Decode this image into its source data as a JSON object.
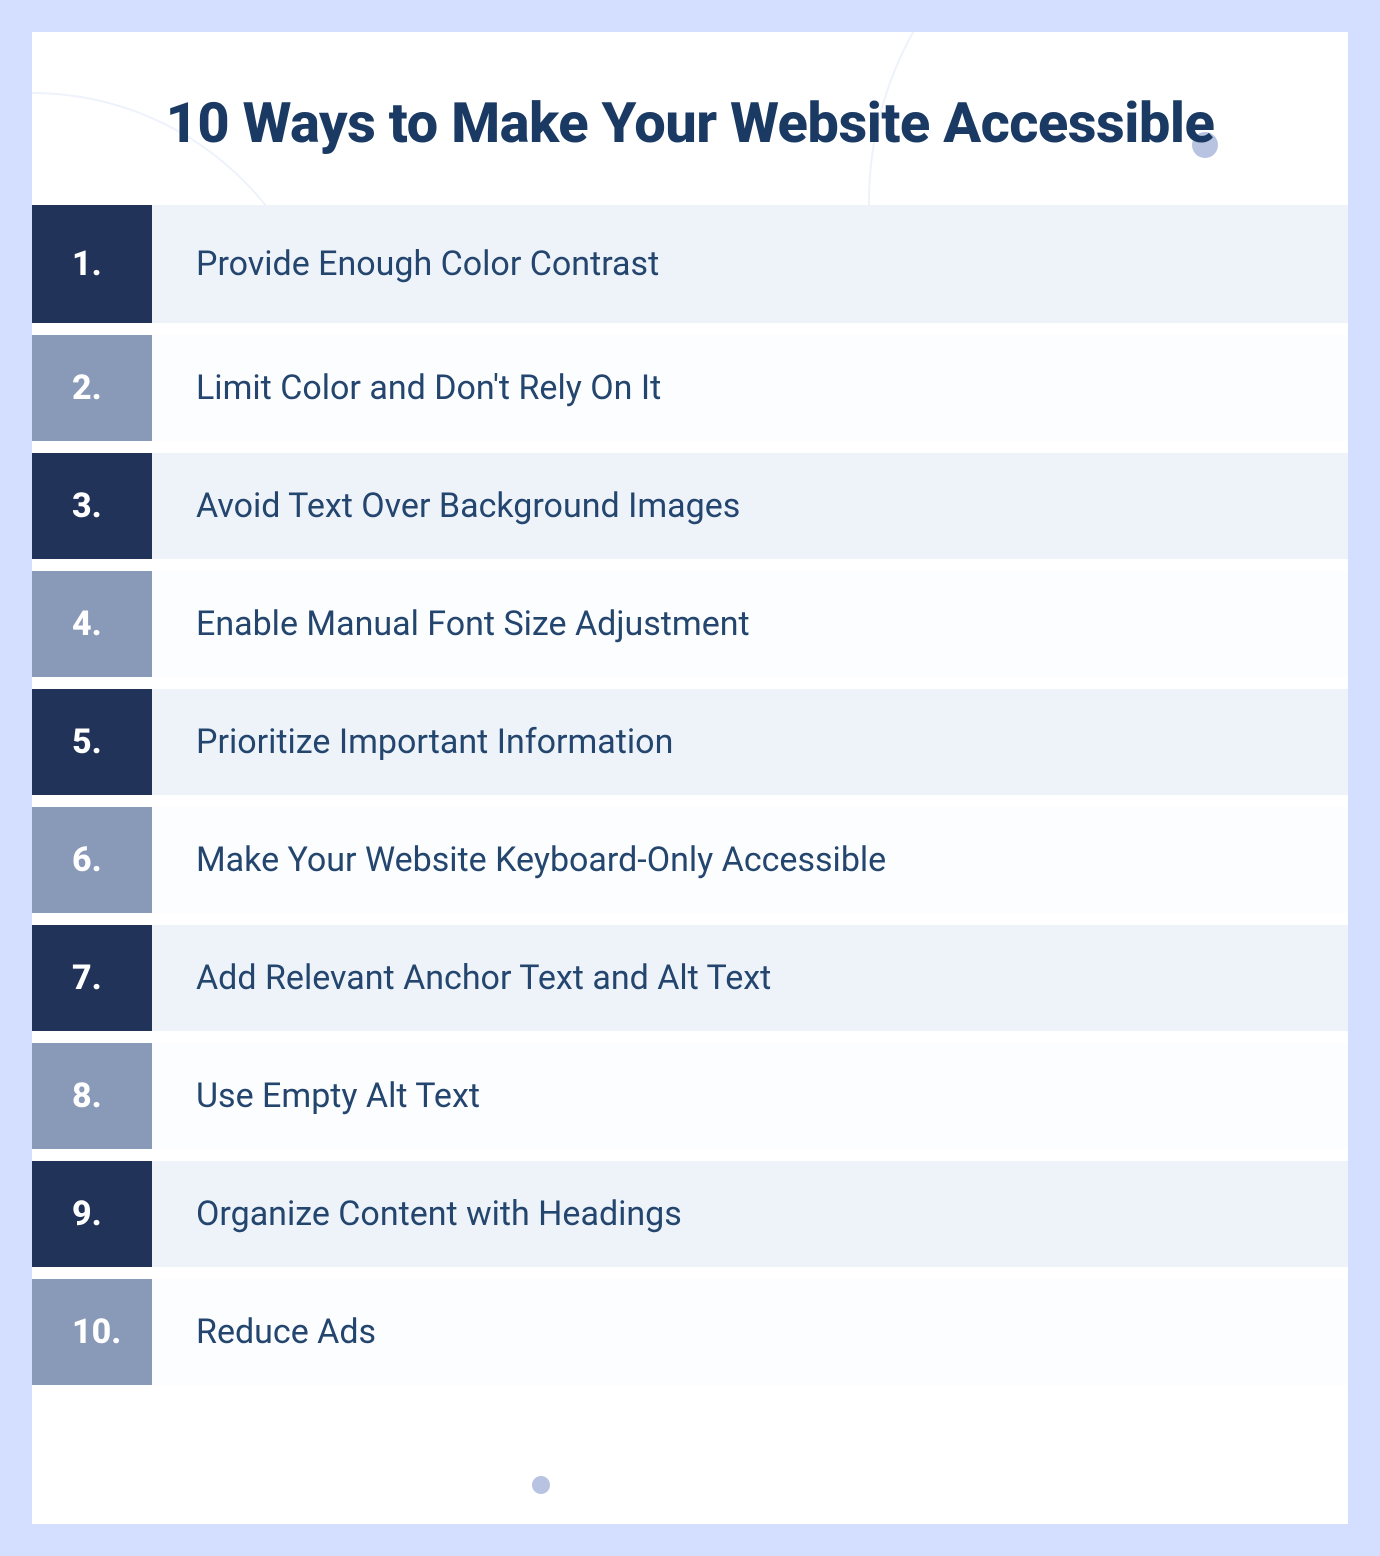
{
  "title": "10 Ways to Make Your Website Accessible",
  "items": [
    {
      "num": "1.",
      "text": "Provide Enough Color Contrast"
    },
    {
      "num": "2.",
      "text": "Limit Color and Don't Rely On It"
    },
    {
      "num": "3.",
      "text": "Avoid Text Over Background Images"
    },
    {
      "num": "4.",
      "text": "Enable Manual Font Size Adjustment"
    },
    {
      "num": "5.",
      "text": "Prioritize Important Information"
    },
    {
      "num": "6.",
      "text": "Make Your Website Keyboard-Only Accessible"
    },
    {
      "num": "7.",
      "text": "Add Relevant Anchor Text and Alt Text"
    },
    {
      "num": "8.",
      "text": "Use Empty Alt Text"
    },
    {
      "num": "9.",
      "text": "Organize Content with Headings"
    },
    {
      "num": "10.",
      "text": "Reduce Ads"
    }
  ]
}
